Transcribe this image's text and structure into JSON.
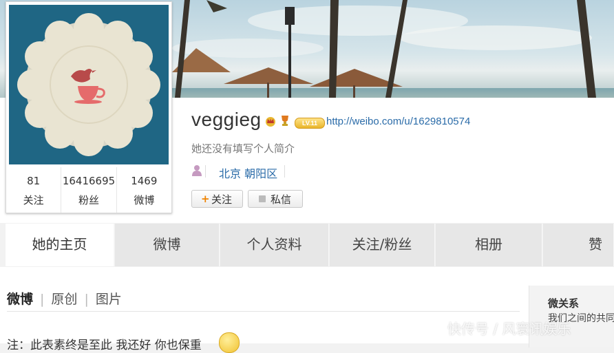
{
  "profile": {
    "username": "veggieg",
    "level_badge": "LV.11",
    "url": "http://weibo.com/u/1629810574",
    "bio": "她还没有填写个人简介",
    "location": "北京 朝阳区",
    "badge_icons": [
      "crown-icon",
      "trophy-icon"
    ]
  },
  "stats": [
    {
      "value": "81",
      "label": "关注"
    },
    {
      "value": "16416695",
      "label": "粉丝"
    },
    {
      "value": "1469",
      "label": "微博"
    }
  ],
  "actions": {
    "follow_label": "关注",
    "message_label": "私信"
  },
  "tabs": [
    {
      "label": "她的主页",
      "active": true
    },
    {
      "label": "微博"
    },
    {
      "label": "个人资料"
    },
    {
      "label": "关注/粉丝"
    },
    {
      "label": "相册"
    },
    {
      "label": "赞"
    }
  ],
  "feed": {
    "filters": [
      "微博",
      "原创",
      "图片"
    ],
    "post_text": "注：此表素终是至此 我还好 你也保重"
  },
  "sidebar": {
    "title": "微关系",
    "subtitle": "我们之间的共同"
  },
  "watermark": "快传号 / 风寰讯娱乐",
  "colors": {
    "link": "#2a6ba8",
    "avatar_bg": "#1f6684",
    "follow_plus": "#f08300"
  }
}
